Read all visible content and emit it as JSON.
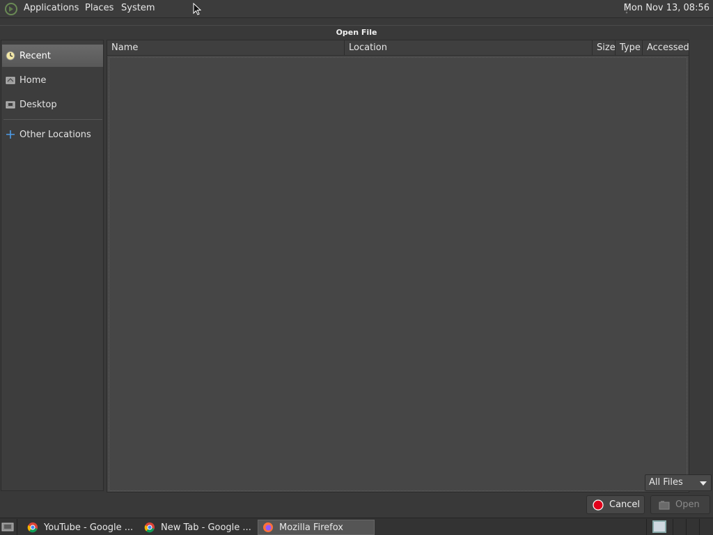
{
  "top_panel": {
    "menus": [
      "Applications",
      "Places",
      "System"
    ],
    "clock": "Mon Nov 13, 08:56"
  },
  "dialog": {
    "title": "Open File",
    "sidebar": {
      "items": [
        {
          "label": "Recent",
          "icon": "clock-icon",
          "selected": true
        },
        {
          "label": "Home",
          "icon": "home-icon",
          "selected": false
        },
        {
          "label": "Desktop",
          "icon": "desktop-icon",
          "selected": false
        },
        {
          "label": "Other Locations",
          "icon": "plus-icon",
          "selected": false
        }
      ]
    },
    "columns": [
      "Name",
      "Location",
      "Size",
      "Type",
      "Accessed"
    ],
    "rows": [],
    "filter": {
      "selected": "All Files"
    },
    "buttons": {
      "cancel": "Cancel",
      "open": "Open"
    }
  },
  "taskbar": {
    "tasks": [
      {
        "label": "YouTube - Google ...",
        "icon": "chrome-icon",
        "active": false
      },
      {
        "label": "New Tab - Google ...",
        "icon": "chrome-icon",
        "active": false
      },
      {
        "label": "Mozilla Firefox",
        "icon": "firefox-icon",
        "active": true
      }
    ]
  },
  "colors": {
    "background": "#3b3b3b",
    "selected_item": "#606060",
    "cancel_icon": "#e0001a"
  }
}
